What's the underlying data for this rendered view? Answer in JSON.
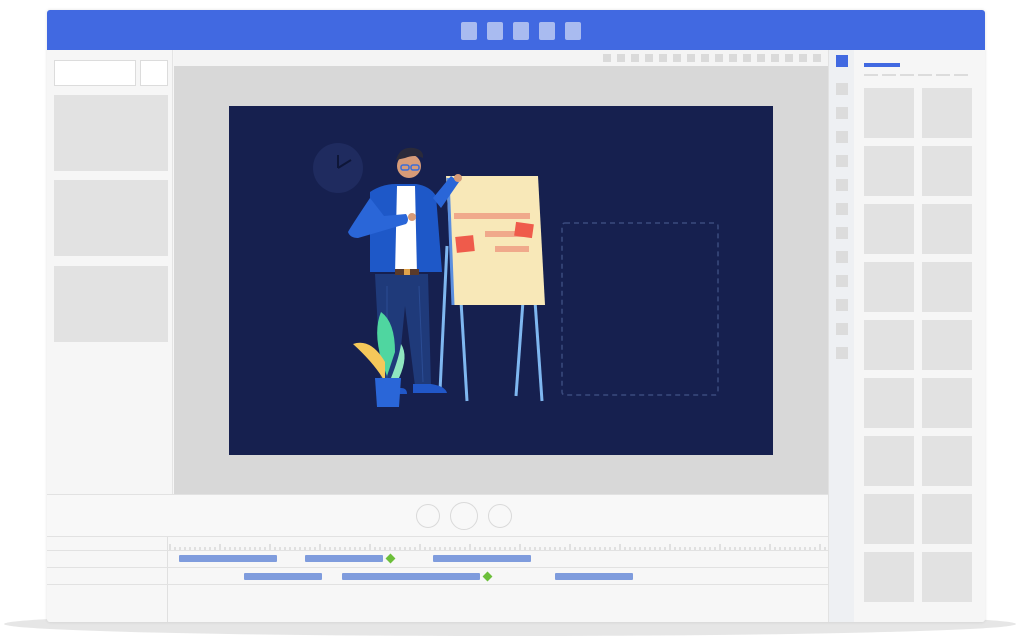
{
  "app": {
    "accent_color": "#4169e1",
    "stage_color": "#16204f"
  },
  "titlebar": {
    "buttons": [
      "toolbar-button",
      "toolbar-button",
      "toolbar-button",
      "toolbar-button",
      "toolbar-button"
    ]
  },
  "canvas": {
    "scene_icons": [
      "clock-icon",
      "presenter-illustration",
      "flipchart-icon",
      "plant-icon",
      "placeholder-frame"
    ]
  },
  "playback": {
    "controls": [
      "previous-icon",
      "play-icon",
      "next-icon"
    ]
  },
  "timeline": {
    "tracks": [
      {
        "clips": 3,
        "keyframes": 1
      },
      {
        "clips": 3,
        "keyframes": 1
      }
    ]
  }
}
